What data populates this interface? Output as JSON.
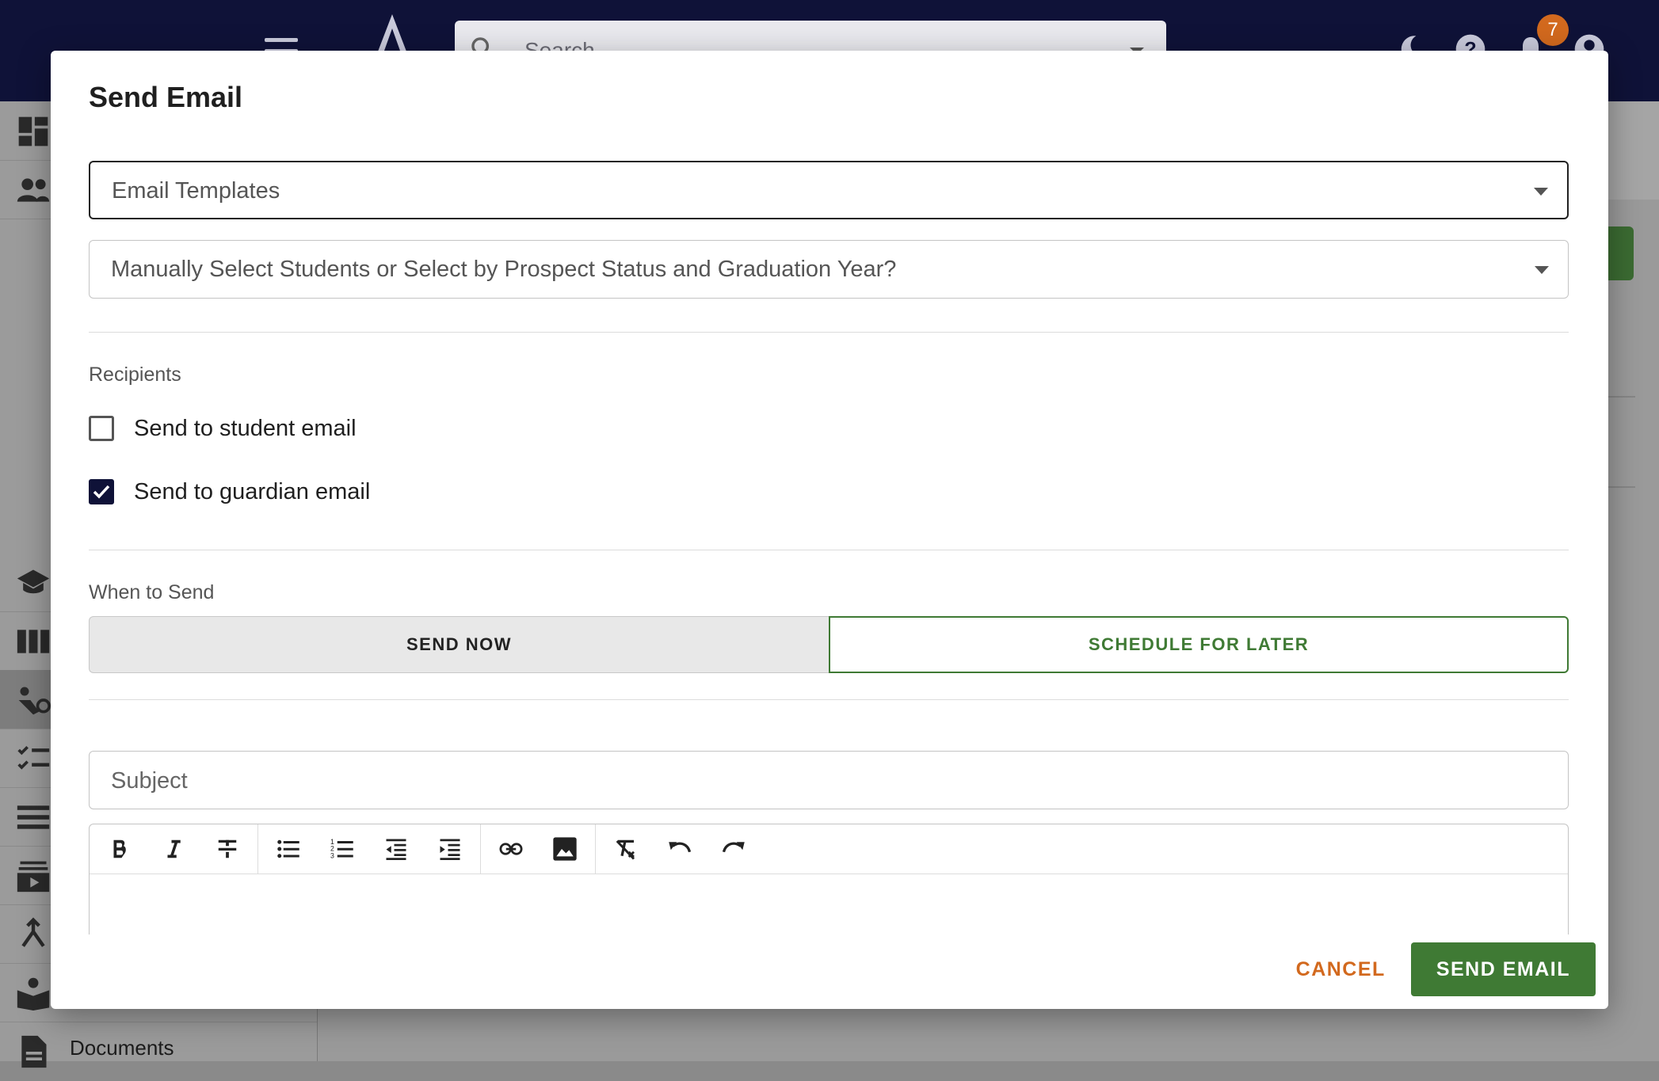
{
  "app": {
    "search_placeholder": "Search",
    "notification_count": "7",
    "sidebar_visible_label": "Documents"
  },
  "dialog": {
    "title": "Send Email",
    "email_templates_select": {
      "value": "Email Templates"
    },
    "selection_mode_select": {
      "value": "Manually Select Students or Select by Prospect Status and Graduation Year?"
    },
    "recipients": {
      "label": "Recipients",
      "student_email": {
        "label": "Send to student email",
        "checked": false
      },
      "guardian_email": {
        "label": "Send to guardian email",
        "checked": true
      }
    },
    "when_to_send": {
      "label": "When to Send",
      "send_now_label": "SEND NOW",
      "schedule_label": "SCHEDULE FOR LATER",
      "selected": "SCHEDULE FOR LATER"
    },
    "subject": {
      "placeholder": "Subject",
      "value": ""
    },
    "editor_toolbar": [
      "bold-icon",
      "italic-icon",
      "strikethrough-icon",
      "bulleted-list-icon",
      "numbered-list-icon",
      "outdent-icon",
      "indent-icon",
      "link-icon",
      "image-icon",
      "clear-format-icon",
      "undo-icon",
      "redo-icon"
    ],
    "actions": {
      "cancel_label": "CANCEL",
      "send_label": "SEND EMAIL"
    }
  },
  "colors": {
    "topbar": "#0f1238",
    "primary_green": "#3f7a34",
    "cancel_orange": "#d2691e",
    "checkbox_checked": "#0f1238"
  }
}
